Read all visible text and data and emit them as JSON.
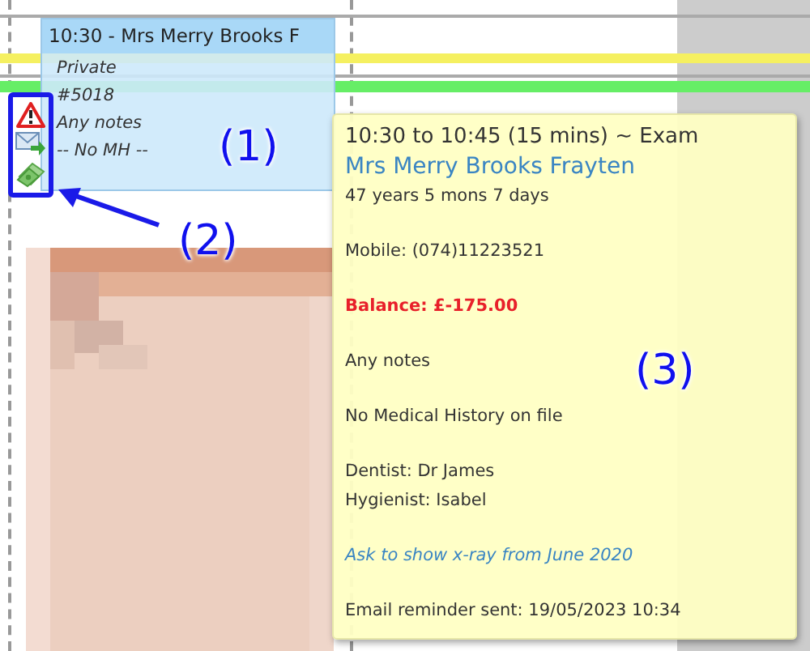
{
  "appointment": {
    "header": "10:30 - Mrs Merry Brooks F",
    "lines": [
      "Private",
      "#5018",
      "Any notes",
      "-- No MH --"
    ],
    "icons": [
      {
        "kind": "warning"
      },
      {
        "kind": "email"
      },
      {
        "kind": "payment"
      }
    ]
  },
  "tooltip": {
    "groups": [
      [
        {
          "kind": "title",
          "text": "10:30 to 10:45 (15 mins) ~ Exam"
        },
        {
          "kind": "name",
          "text": "Mrs Merry Brooks Frayten"
        },
        {
          "kind": "plain",
          "text": "47 years 5 mons 7 days"
        }
      ],
      [
        {
          "kind": "plain",
          "text": "Mobile: (074)11223521"
        }
      ],
      [
        {
          "kind": "balance",
          "text": "Balance: £-175.00"
        }
      ],
      [
        {
          "kind": "plain",
          "text": "Any notes"
        }
      ],
      [
        {
          "kind": "plain",
          "text": "No Medical History on file"
        }
      ],
      [
        {
          "kind": "plain",
          "text": "Dentist: Dr James"
        },
        {
          "kind": "plain",
          "text": "Hygienist: Isabel"
        }
      ],
      [
        {
          "kind": "note",
          "text": "Ask to show x-ray from June 2020"
        }
      ],
      [
        {
          "kind": "plain",
          "text": "Email reminder sent: 19/05/2023 10:34"
        }
      ]
    ]
  },
  "annotations": [
    "(1)",
    "(2)",
    "(3)"
  ]
}
